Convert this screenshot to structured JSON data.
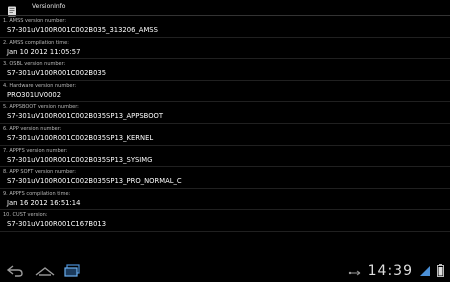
{
  "app": {
    "title": "VersionInfo"
  },
  "items": [
    {
      "label": "1. AMSS version number:",
      "value": "S7-301uV100R001C002B035_313206_AMSS"
    },
    {
      "label": "2. AMSS compilation time:",
      "value": "Jan 10 2012  11:05:57"
    },
    {
      "label": "3. OSBL version number:",
      "value": "S7-301uV100R001C002B035"
    },
    {
      "label": "4. Hardware version number:",
      "value": "PRO301UV0002"
    },
    {
      "label": "5. APPSBOOT version number:",
      "value": "S7-301uV100R001C002B035SP13_APPSBOOT"
    },
    {
      "label": "6. APP version number:",
      "value": "S7-301uV100R001C002B035SP13_KERNEL"
    },
    {
      "label": "7. APPFS version number:",
      "value": "S7-301uV100R001C002B035SP13_SYSIMG"
    },
    {
      "label": "8. APP SOFT version number:",
      "value": "S7-301uV100R001C002B035SP13_PRO_NORMAL_C"
    },
    {
      "label": "9. APPFS compilation time:",
      "value": "Jan 16 2012 16:51:14"
    },
    {
      "label": "10. CUST version:",
      "value": "S7-301uV100R001C167B013"
    }
  ],
  "status": {
    "time": "14:39"
  },
  "colors": {
    "accent": "#4a8fd6",
    "background": "#000000"
  }
}
